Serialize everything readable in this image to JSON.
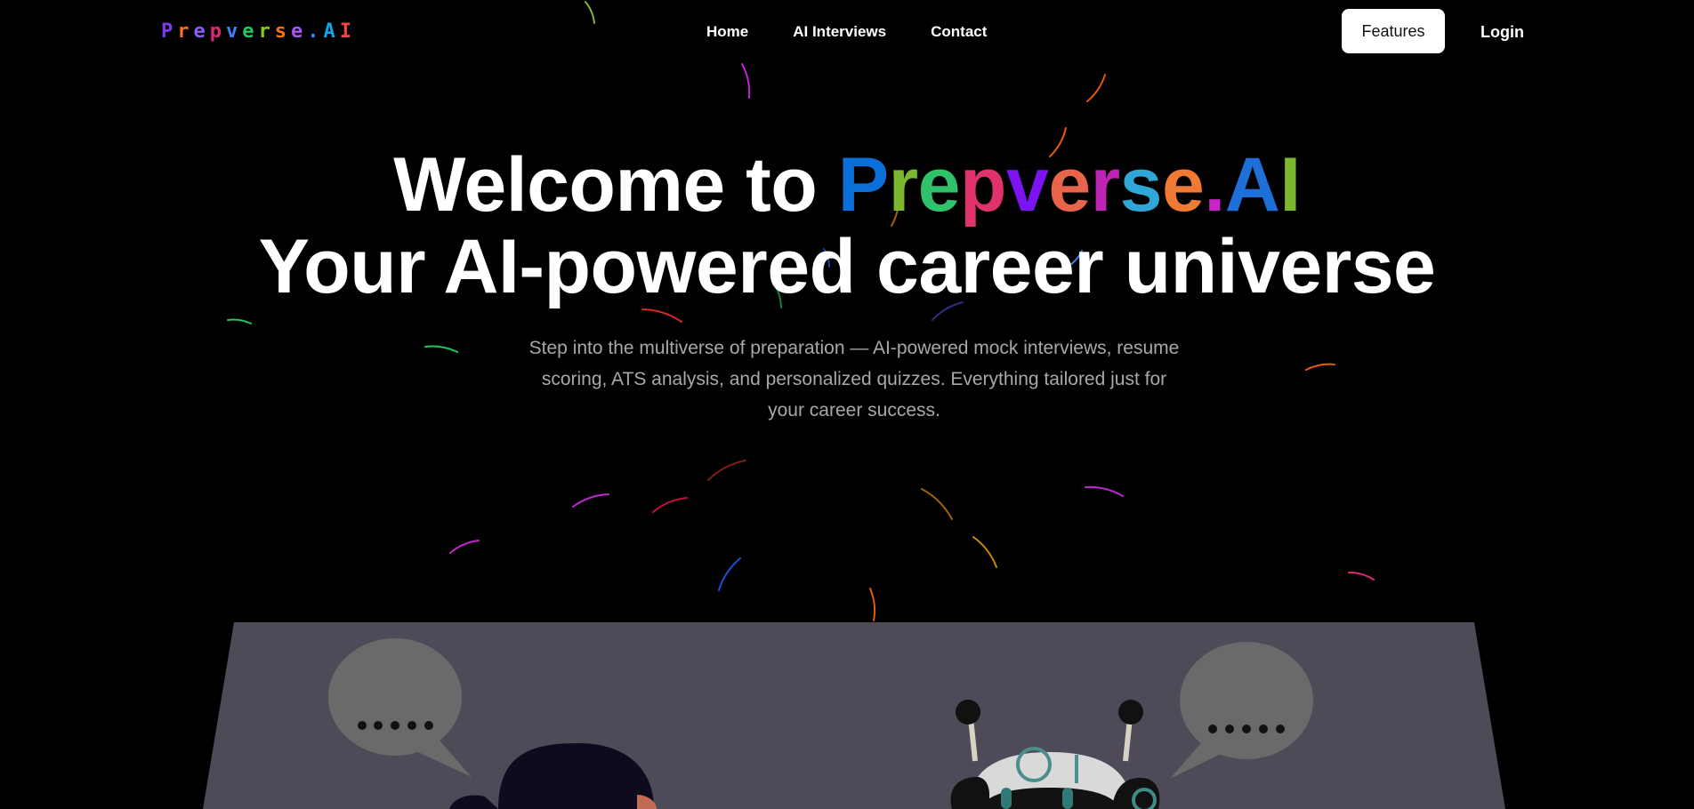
{
  "nav": {
    "logo_letters": [
      "P",
      "r",
      "e",
      "p",
      "v",
      "e",
      "r",
      "s",
      "e",
      ".",
      "A",
      "I"
    ],
    "links": [
      "Home",
      "AI Interviews",
      "Contact"
    ],
    "features_label": "Features",
    "login_label": "Login"
  },
  "hero": {
    "title_prefix": "Welcome to ",
    "brand_letters": [
      "P",
      "r",
      "e",
      "p",
      "v",
      "e",
      "r",
      "s",
      "e",
      ".",
      "A",
      "I"
    ],
    "title_line2": "Your AI-powered career universe",
    "subtitle": "Step into the multiverse of preparation — AI-powered mock interviews, resume scoring, ATS analysis, and personalized quizzes. Everything tailored just for your career success."
  },
  "illustration": {
    "left_bubble_text": ".....",
    "right_bubble_text": "....."
  },
  "colors": {
    "background": "#000000",
    "logo_letters": [
      "#7c3aed",
      "#f97316",
      "#8b5cf6",
      "#db2777",
      "#3b82f6",
      "#22c55e",
      "#84cc16",
      "#f97316",
      "#a855f7",
      "#3b82f6",
      "#0ea5e9",
      "#ef4444"
    ],
    "brand_letters": [
      "#0a6fd8",
      "#7cb82f",
      "#2ec26b",
      "#e0336c",
      "#7c13f0",
      "#e8644a",
      "#c024b6",
      "#2fa8d8",
      "#f07a32",
      "#cc22cc",
      "#1e6fd8",
      "#7cb82f"
    ],
    "panel": "#4f4a58",
    "bubble": "#6a6a6a"
  }
}
